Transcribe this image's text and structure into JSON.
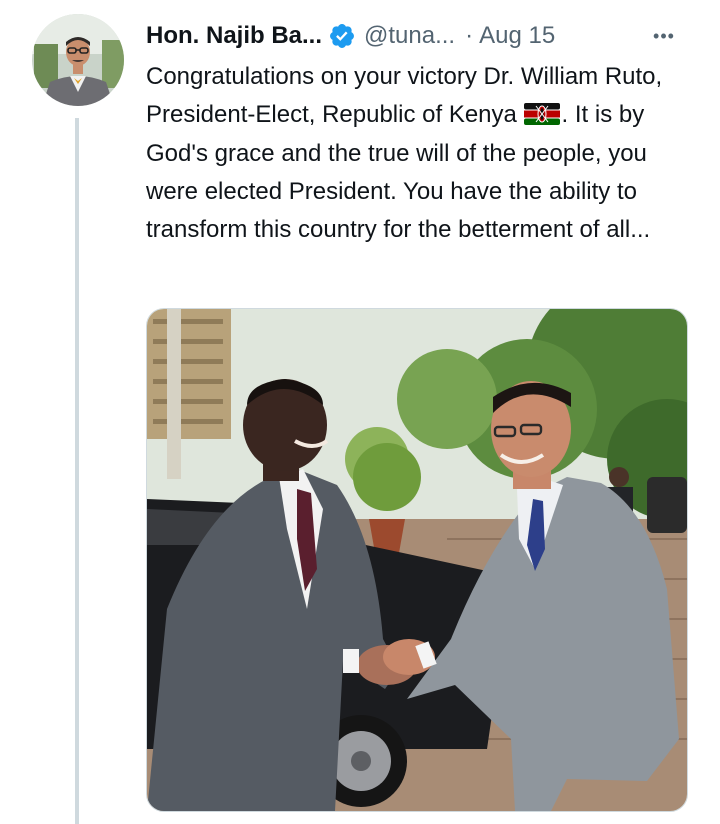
{
  "author": {
    "name": "Hon. Najib Ba...",
    "handle": "@tuna...",
    "separator": "·",
    "date": "Aug 15"
  },
  "more_glyph": "•••",
  "tweet": {
    "text_before_flag": "Congratulations on your victory Dr. William Ruto, President-Elect, Republic of Kenya ",
    "text_after_flag": ". It is by God's grace and the true will of the people, you were elected President. You have the ability to transform this country for the betterment of all..."
  },
  "icons": {
    "verified": "verified-badge-icon",
    "more": "more-horizontal-icon",
    "flag": "kenya-flag-emoji"
  },
  "colors": {
    "verified_blue": "#1d9bf0",
    "secondary_text": "#536471",
    "thread_line": "#cfd9de"
  }
}
